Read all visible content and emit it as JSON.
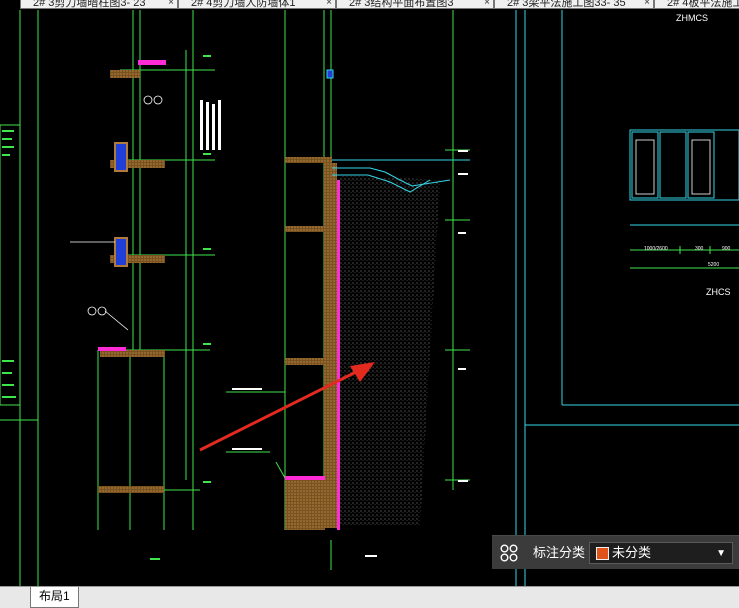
{
  "tabs": [
    {
      "label": "2# 3剪力墙暗柱图3- 23",
      "close": "×"
    },
    {
      "label": "2# 4剪力墙人防墙体1",
      "close": "×"
    },
    {
      "label": "2# 3结构平面布置图3",
      "close": "×"
    },
    {
      "label": "2# 3梁平法施工图33- 35",
      "close": "×"
    },
    {
      "label": "2# 4板平法施工",
      "close": ""
    }
  ],
  "drawing": {
    "label_zhmcs": "ZHMCS",
    "label_zhcs": "ZHCS",
    "dim_1": "1000/2600",
    "dim_2": "300",
    "dim_3": "900",
    "dim_total": "5200"
  },
  "annotation_panel": {
    "icon": "annotation-categories-icon",
    "label": "标注分类",
    "selected_value": "未分类",
    "swatch_color": "#e0531a"
  },
  "layout_tabs": [
    {
      "label": "布局1"
    }
  ],
  "colors": {
    "background": "#000000",
    "green": "#3fe64b",
    "cyan": "#33d6e6",
    "magenta": "#ff2bd6",
    "brown": "#b07a3c",
    "arrow_red": "#e32a1f",
    "white": "#ffffff"
  }
}
